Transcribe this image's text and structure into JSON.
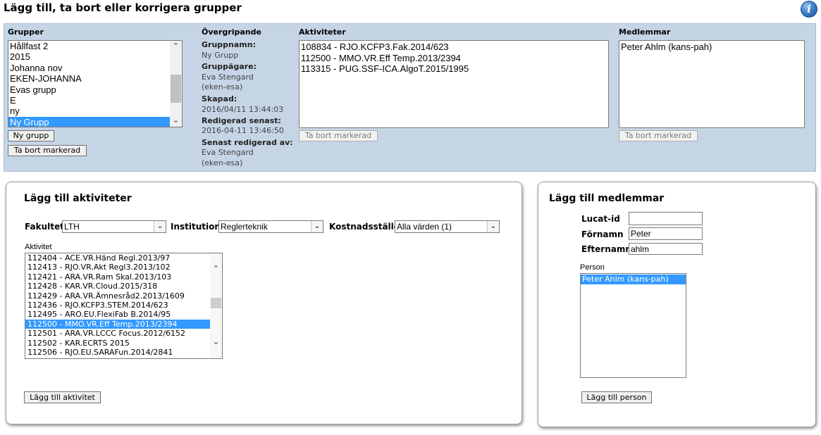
{
  "page": {
    "title": "Lägg till, ta bort eller korrigera grupper",
    "info_icon": "i"
  },
  "groups": {
    "label": "Grupper",
    "items": [
      "Hållfast 2",
      "2015",
      "Johanna nov",
      "EKEN-JOHANNA",
      "Evas grupp",
      "E",
      "ny",
      "Ny Grupp"
    ],
    "selected": "Ny Grupp",
    "new_button": "Ny grupp",
    "remove_button": "Ta bort markerad"
  },
  "overview": {
    "label": "Övergripande",
    "group_name_label": "Gruppnamn:",
    "group_name": "Ny Grupp",
    "owner_label": "Gruppägare:",
    "owner_name": "Eva Stengard",
    "owner_id": "(eken-esa)",
    "created_label": "Skapad:",
    "created": "2016/04/11 13:44:03",
    "edited_label": "Redigerad senast:",
    "edited": "2016-04-11 13:46:50",
    "edited_by_label": "Senast redigerad av:",
    "edited_by_name": "Eva Stengard",
    "edited_by_id": "(eken-esa)"
  },
  "activities": {
    "label": "Aktiviteter",
    "items": [
      "108834 - RJO.KCFP3.Fak.2014/623",
      "112500 - MMO.VR.Eff Temp.2013/2394",
      "113315 - PUG.SSF-ICA.AlgoT.2015/1995"
    ],
    "remove_button": "Ta bort markerad"
  },
  "members": {
    "label": "Medlemmar",
    "items": [
      "Peter Ahlm (kans-pah)"
    ],
    "remove_button": "Ta bort markerad"
  },
  "add_activities": {
    "title": "Lägg till aktiviteter",
    "faculty_label": "Fakultet",
    "faculty_value": "LTH",
    "institution_label": "Institution",
    "institution_value": "Reglerteknik",
    "cost_center_label": "Kostnadsställe",
    "cost_center_value": "Alla värden (1)",
    "activity_label": "Aktivitet",
    "items": [
      "112404 - ACE.VR.Händ Regl.2013/97",
      "112413 - RJO.VR.Akt Regl3.2013/102",
      "112421 - ARA.VR.Ram Skal.2013/103",
      "112428 - KAR.VR.Cloud.2015/318",
      "112429 - ARA.VR.Ämnesråd2.2013/1609",
      "112436 - RJO.KCFP3.STEM.2014/623",
      "112495 - ARO.EU.FlexiFab B.2014/95",
      "112500 - MMO.VR.Eff Temp.2013/2394",
      "112501 - ARA.VR.LCCC Focus.2012/6152",
      "112502 - KAR.ECRTS 2015",
      "112506 - RJO.EU.SARAFun.2014/2841"
    ],
    "selected": "112500 - MMO.VR.Eff Temp.2013/2394",
    "add_button": "Lägg till aktivitet"
  },
  "add_members": {
    "title": "Lägg till medlemmar",
    "lucat_label": "Lucat-id",
    "lucat_value": "",
    "first_name_label": "Förnamn",
    "first_name_value": "Peter",
    "last_name_label": "Efternamn",
    "last_name_value": "ahlm",
    "person_label": "Person",
    "persons": [
      "Peter Ahlm (kans-pah)"
    ],
    "selected": "Peter Ahlm (kans-pah)",
    "add_button": "Lägg till person"
  },
  "colors": {
    "panel_bg": "#c6d5e6",
    "selection": "#3399ff"
  }
}
